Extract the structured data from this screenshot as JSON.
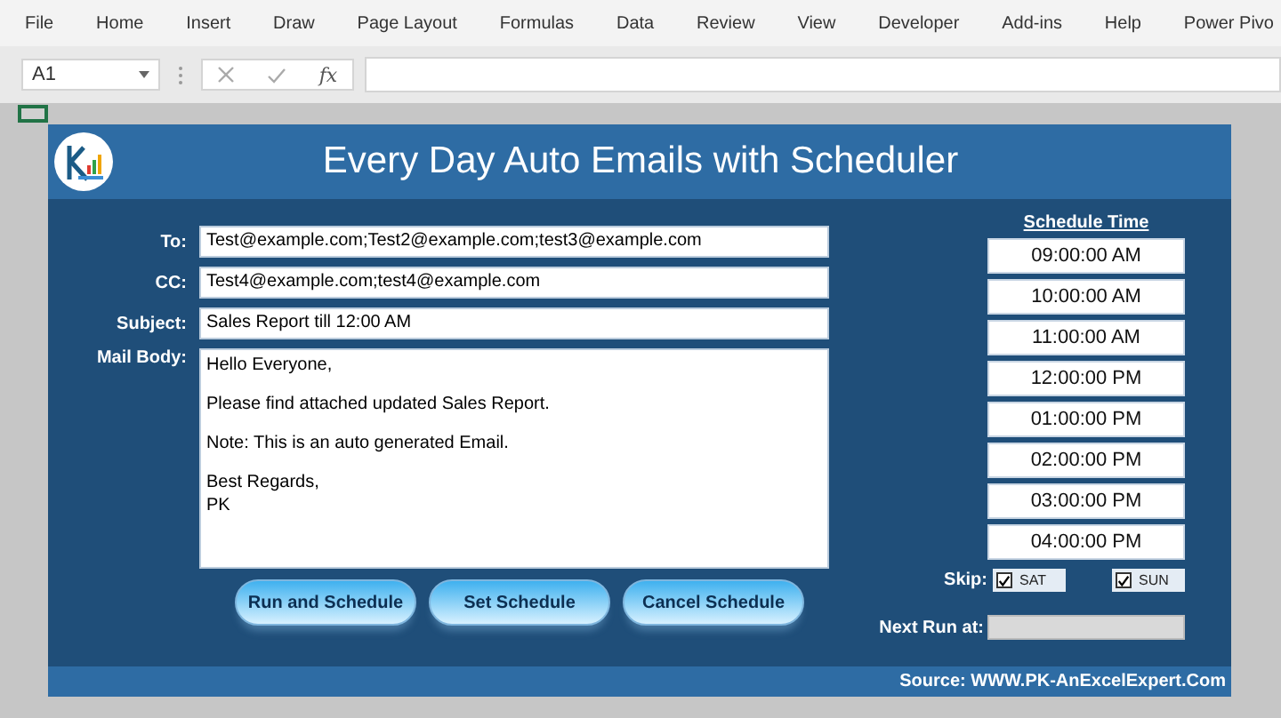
{
  "ribbon_tabs": [
    "File",
    "Home",
    "Insert",
    "Draw",
    "Page Layout",
    "Formulas",
    "Data",
    "Review",
    "View",
    "Developer",
    "Add-ins",
    "Help",
    "Power Pivo"
  ],
  "formula_bar": {
    "name_box": "A1",
    "fx": "fx"
  },
  "form": {
    "title": "Every Day Auto Emails with Scheduler",
    "fields": [
      {
        "label": "To:",
        "value": "Test@example.com;Test2@example.com;test3@example.com"
      },
      {
        "label": "CC:",
        "value": "Test4@example.com;test4@example.com"
      },
      {
        "label": "Subject:",
        "value": "Sales Report till 12:00 AM"
      }
    ],
    "mail_body": {
      "label": "Mail Body:",
      "paragraphs": [
        "Hello Everyone,",
        "Please find attached updated Sales Report.",
        "Note: This is an auto generated Email.",
        "Best Regards,\nPK"
      ]
    },
    "buttons": [
      "Run and Schedule",
      "Set Schedule",
      "Cancel Schedule"
    ],
    "schedule": {
      "heading": "Schedule Time",
      "times": [
        "09:00:00 AM",
        "10:00:00 AM",
        "11:00:00 AM",
        "12:00:00 PM",
        "01:00:00 PM",
        "02:00:00 PM",
        "03:00:00 PM",
        "04:00:00 PM"
      ]
    },
    "skip": {
      "label": "Skip:",
      "days": [
        {
          "label": "SAT",
          "checked": true
        },
        {
          "label": "SUN",
          "checked": true
        }
      ]
    },
    "next_run": {
      "label": "Next Run at:"
    },
    "source": "Source: WWW.PK-AnExcelExpert.Com"
  }
}
